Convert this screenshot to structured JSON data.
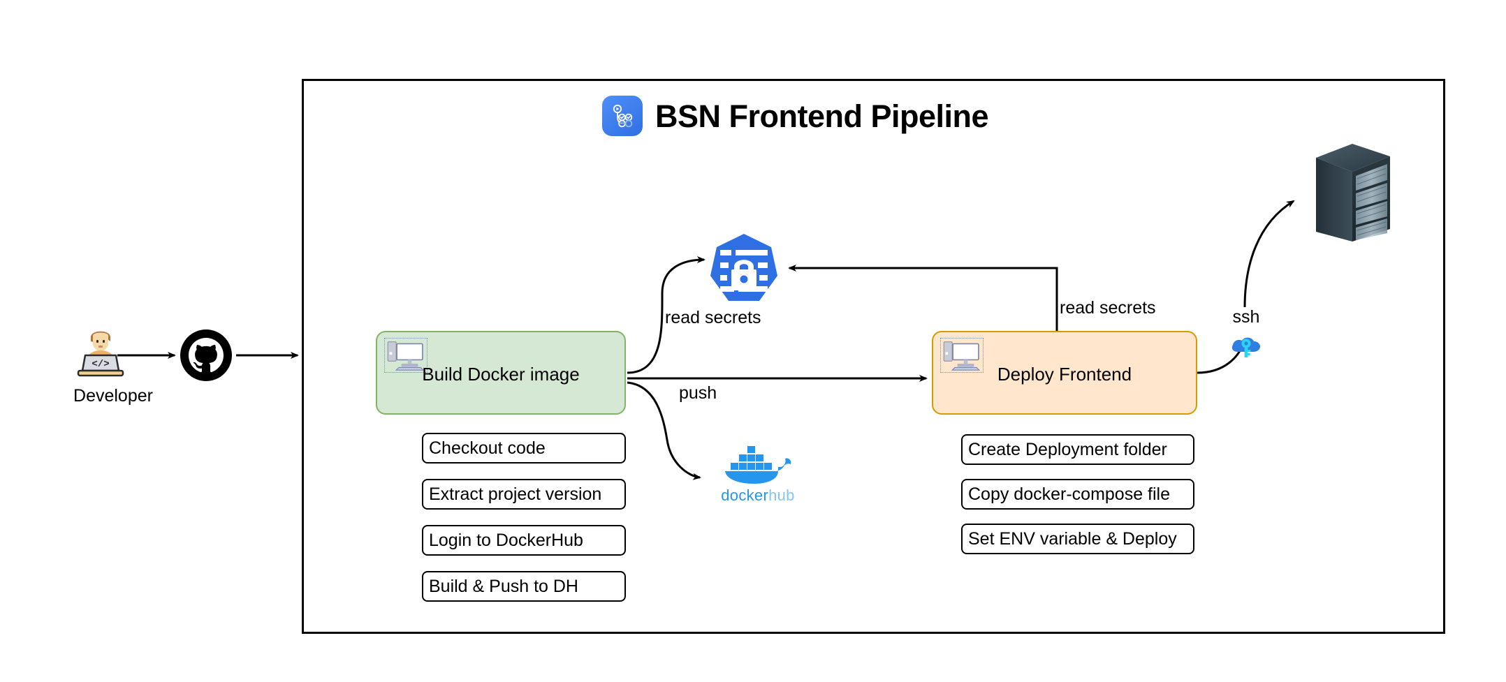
{
  "pipeline": {
    "title": "BSN Frontend Pipeline",
    "icon": "github-actions-icon"
  },
  "source": {
    "developer": {
      "label": "Developer",
      "icon": "developer-at-laptop-icon"
    },
    "repository": {
      "icon": "github-octocat-icon"
    }
  },
  "jobs": [
    {
      "id": "build",
      "label": "Build Docker image",
      "icon": "computer-icon",
      "fill": "#d5e8d4",
      "stroke": "#82b366",
      "steps": [
        "Checkout code",
        "Extract project version",
        "Login to DockerHub",
        "Build & Push to DH"
      ]
    },
    {
      "id": "deploy",
      "label": "Deploy Frontend",
      "icon": "computer-icon",
      "fill": "#ffe6cc",
      "stroke": "#d79b00",
      "steps": [
        "Create Deployment folder",
        "Copy docker-compose file",
        "Set ENV variable & Deploy"
      ]
    }
  ],
  "resources": {
    "secrets": {
      "icon": "secrets-lock-icon",
      "color": "#2f6fe4"
    },
    "dockerhub": {
      "icon": "docker-whale-icon",
      "wordmark_primary": "docker",
      "wordmark_secondary": "hub",
      "color_primary": "#2496ed",
      "color_secondary": "#86c5f2"
    },
    "ssh": {
      "label": "ssh",
      "icon": "ssh-cloud-key-icon"
    },
    "server": {
      "icon": "server-rack-icon"
    }
  },
  "edges": [
    {
      "id": "dev-to-repo",
      "label": ""
    },
    {
      "id": "repo-to-build",
      "label": ""
    },
    {
      "id": "build-to-secrets",
      "label": "read secrets"
    },
    {
      "id": "build-to-dockerhub",
      "label": "push"
    },
    {
      "id": "build-to-deploy",
      "label": ""
    },
    {
      "id": "deploy-to-secrets",
      "label": "read secrets"
    },
    {
      "id": "ssh-to-server",
      "label": ""
    }
  ],
  "edge_labels": {
    "read_secrets_build": "read secrets",
    "push": "push",
    "read_secrets_deploy": "read secrets"
  }
}
